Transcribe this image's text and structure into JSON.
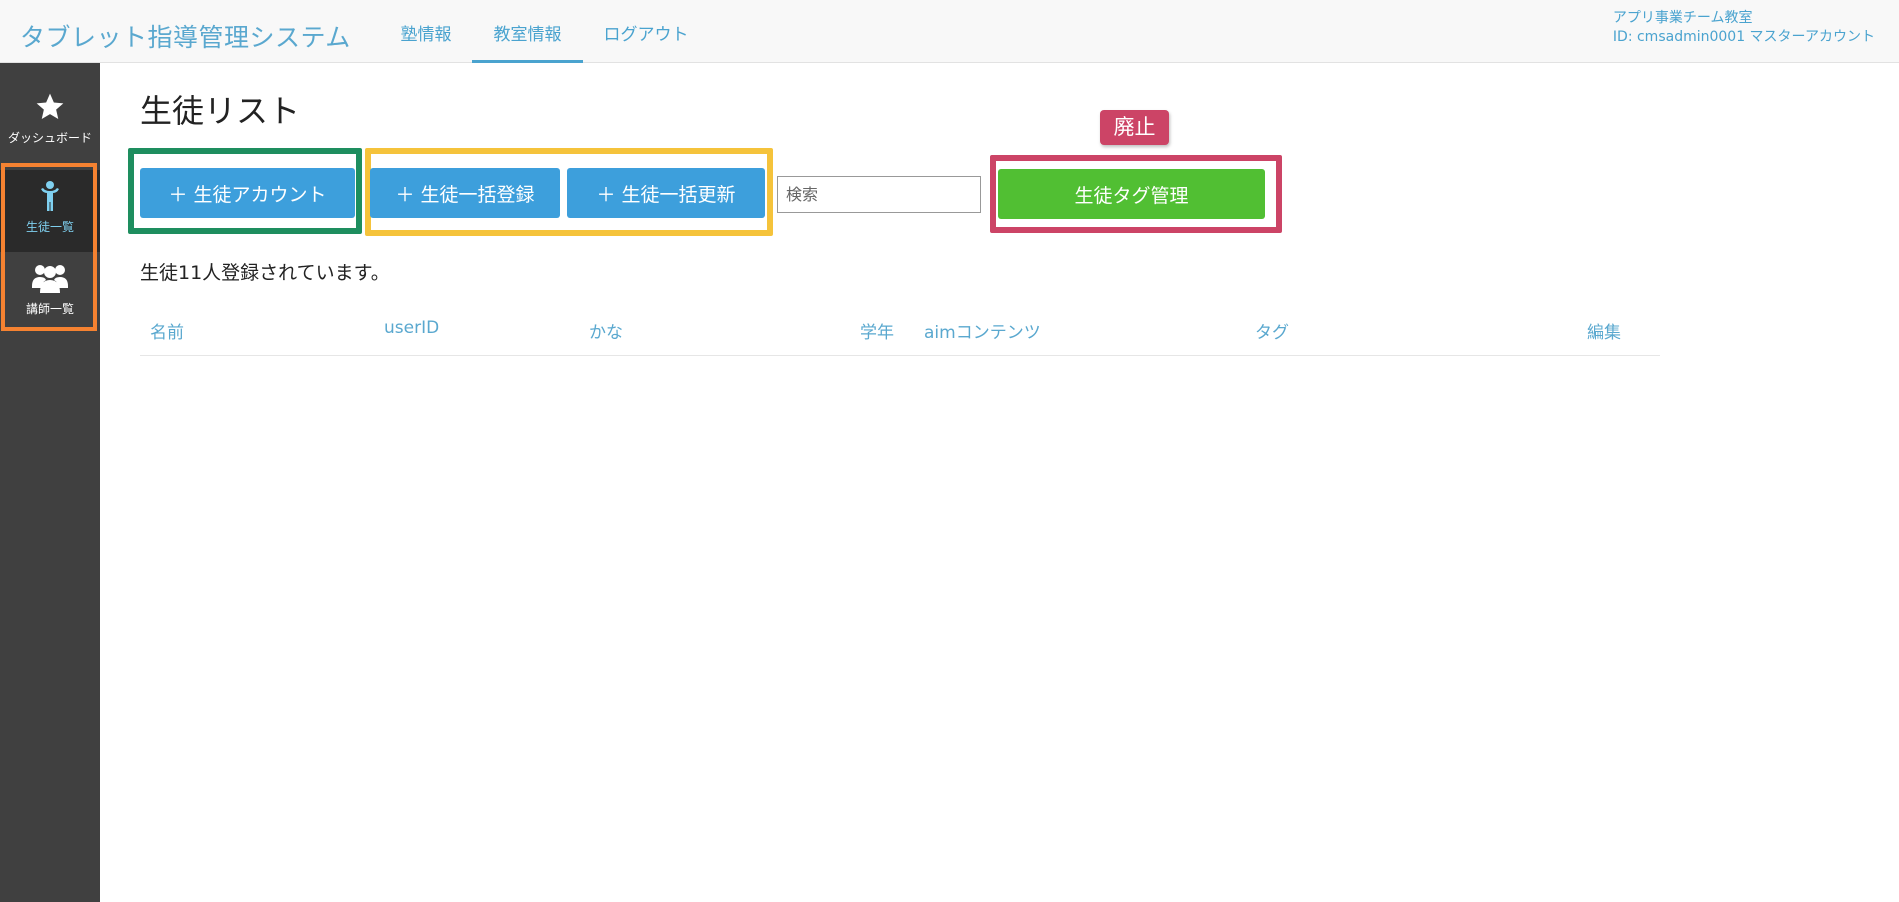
{
  "header": {
    "title": "タブレット指導管理システム",
    "nav": [
      "塾情報",
      "教室情報",
      "ログアウト"
    ],
    "active_nav": "教室情報",
    "account_line1": "アプリ事業チーム教室",
    "account_line2": "ID: cmsadmin0001 マスターアカウント"
  },
  "sidebar": {
    "items": [
      {
        "label": "ダッシュボード",
        "icon": "star-icon"
      },
      {
        "label": "生徒一覧",
        "icon": "student-icon"
      },
      {
        "label": "講師一覧",
        "icon": "teachers-icon"
      }
    ],
    "active": "生徒一覧"
  },
  "main": {
    "title": "生徒リスト",
    "buttons": {
      "add_account": "＋ 生徒アカウント",
      "bulk_register": "＋ 生徒一括登録",
      "bulk_update": "＋ 生徒一括更新",
      "tag_manage": "生徒タグ管理"
    },
    "search_placeholder": "検索",
    "abolish_label": "廃止",
    "count_text": "生徒11人登録されています。",
    "table": {
      "headers": [
        "名前",
        "userID",
        "かな",
        "学年",
        "aimコンテンツ",
        "タグ",
        "編集"
      ],
      "rows": []
    }
  },
  "colors": {
    "accent": "#4aa3cf",
    "primary_button": "#3d9fdc",
    "tag_button": "#51bf33",
    "sidebar_bg": "#404040",
    "highlight_green": "#1e8e5f",
    "highlight_yellow": "#f5c33b",
    "highlight_red": "#cc4466",
    "highlight_orange": "#f58231"
  }
}
